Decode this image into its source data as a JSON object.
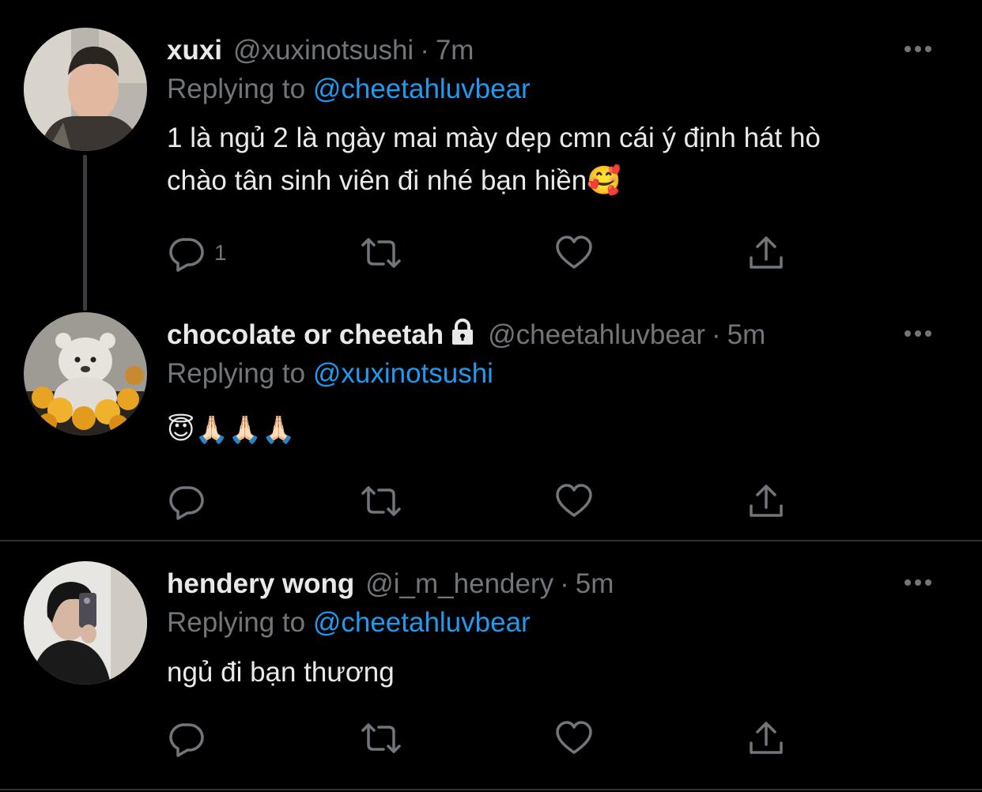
{
  "tweets": [
    {
      "name": "xuxi",
      "handle": "@xuxinotsushi",
      "separator": "·",
      "time": "7m",
      "replying_prefix": "Replying to ",
      "replying_to": "@cheetahluvbear",
      "text_line1": "1 là ngủ 2 là ngày mai mày dẹp cmn cái ý định hát hò",
      "text_line2": "chào tân sinh viên đi nhé bạn hiền",
      "text_emoji": "🥰",
      "reply_count": "1",
      "avatar_icon": "person-photo"
    },
    {
      "name": "chocolate or cheetah",
      "protected": true,
      "handle": "@cheetahluvbear",
      "separator": "·",
      "time": "5m",
      "replying_prefix": "Replying to ",
      "replying_to": "@xuxinotsushi",
      "text_emoji": "😇🙏🏻🙏🏻🙏🏻",
      "reply_count": "",
      "avatar_icon": "teddy-bear-photo"
    },
    {
      "name": "hendery wong",
      "handle": "@i_m_hendery",
      "separator": "·",
      "time": "5m",
      "replying_prefix": "Replying to ",
      "replying_to": "@cheetahluvbear",
      "text_line1": "ngủ đi bạn thương",
      "reply_count": "",
      "avatar_icon": "mirror-selfie-photo"
    }
  ],
  "colors": {
    "background": "#000000",
    "text": "#e7e9ea",
    "secondary": "#71767b",
    "accent": "#1d9bf0",
    "divider": "#2f3336"
  },
  "icons": [
    "reply-icon",
    "retweet-icon",
    "like-icon",
    "share-icon",
    "more-icon",
    "lock-icon"
  ]
}
